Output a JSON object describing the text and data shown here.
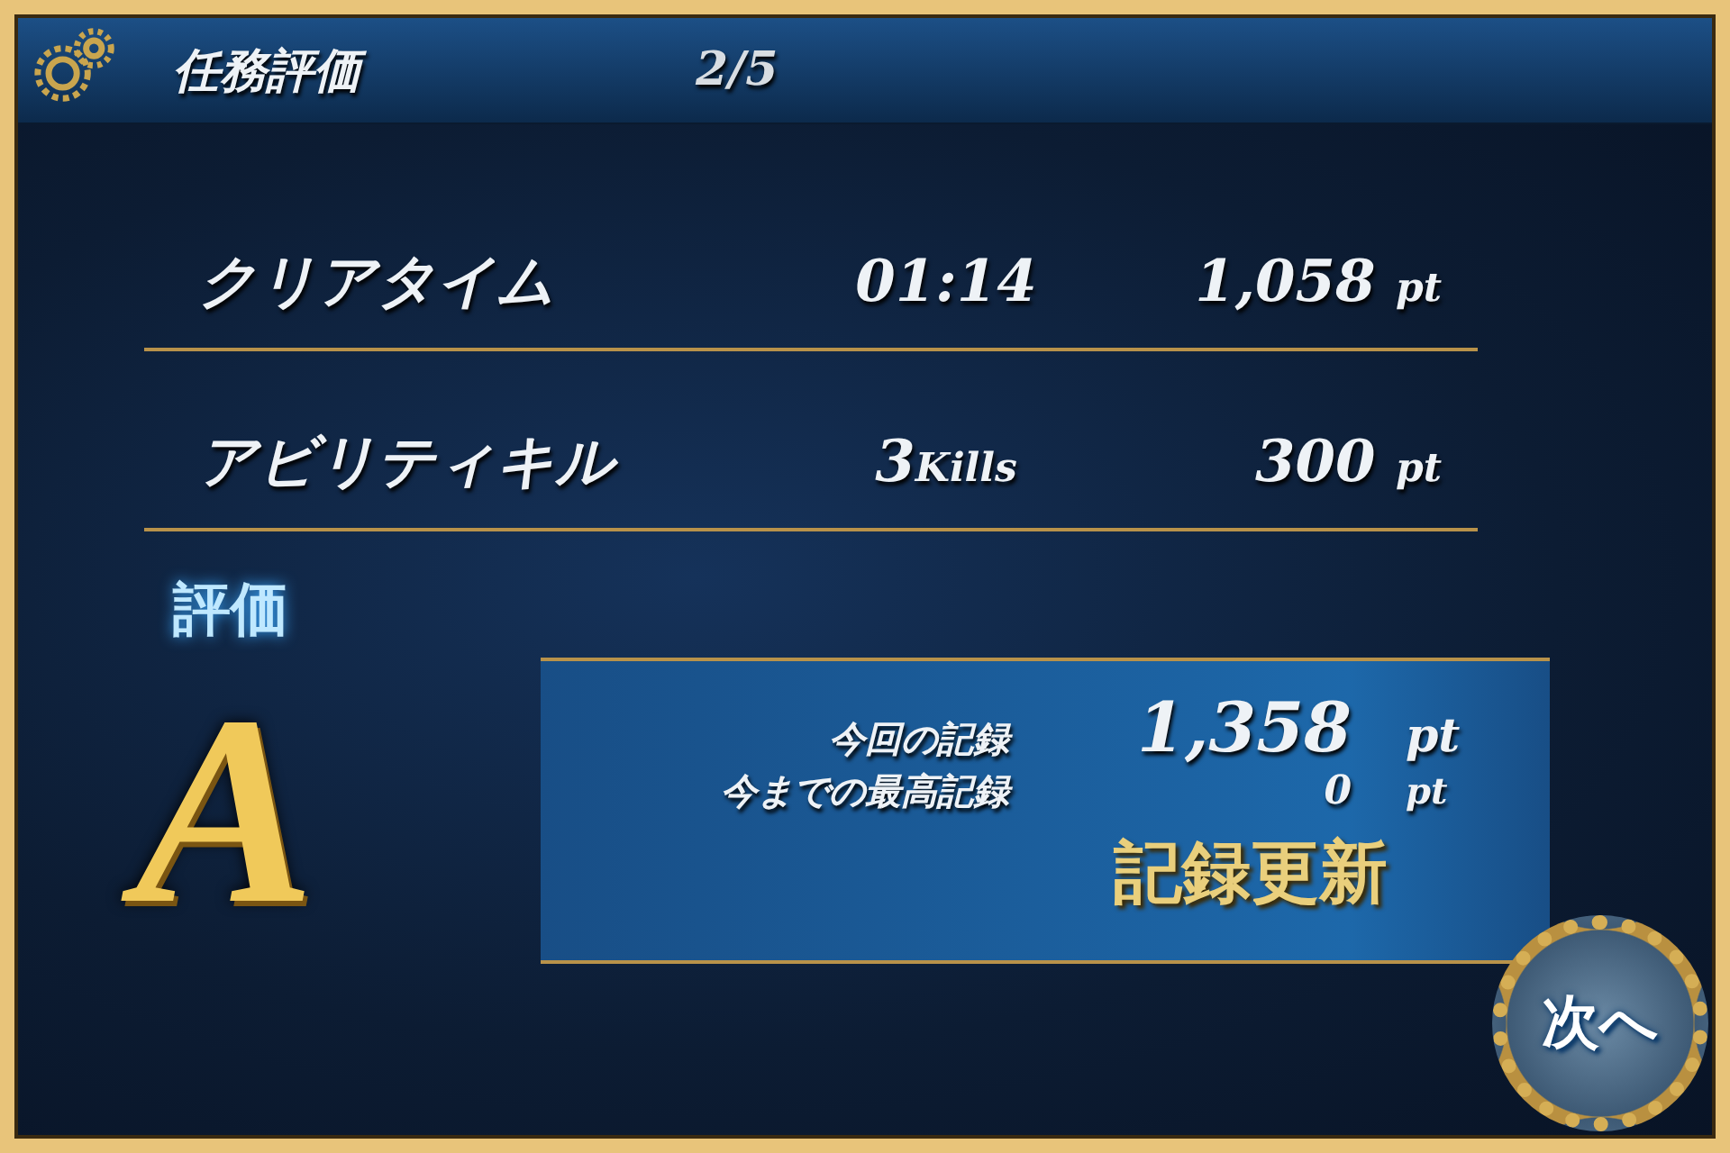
{
  "header": {
    "title": "任務評価",
    "progress": "2/5"
  },
  "scores": [
    {
      "label": "クリアタイム",
      "value": "01:14",
      "points": "1,058",
      "points_unit": "pt"
    },
    {
      "label": "アビリティキル",
      "value": "3",
      "unit": "Kills",
      "points": "300",
      "points_unit": "pt"
    }
  ],
  "rating": {
    "label": "評価",
    "grade": "A"
  },
  "record": {
    "rows": [
      {
        "label": "今回の記録",
        "value": "1,358",
        "unit": "pt"
      },
      {
        "label": "今までの最高記録",
        "value": "0",
        "unit": "pt"
      }
    ],
    "new_record": "記録更新"
  },
  "next_button": "次へ"
}
